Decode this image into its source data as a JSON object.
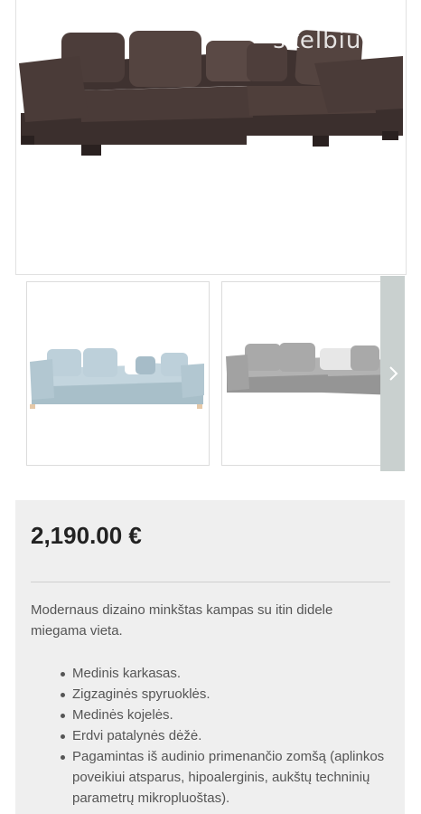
{
  "gallery": {
    "watermark": "skelbiu.lt",
    "next_icon": "chevron-right-icon"
  },
  "listing": {
    "price": "2,190.00 €",
    "description": "Modernaus dizaino minkštas kampas su itin didele miegama vieta.",
    "features": [
      "Medinis karkasas.",
      "Zigzaginės spyruoklės.",
      "Medinės kojelės.",
      "Erdvi patalynės dėžė.",
      "Pagamintas iš audinio primenančio zomšą (aplinkos poveikiui atsparus, hipoalerginis, aukštų techninių parametrų mikropluoštas)."
    ]
  },
  "colors": {
    "main_sofa": "#4a3b38",
    "thumb1_sofa": "#b9ccd6",
    "thumb2_sofa": "#a7a7a7",
    "arrow_bg": "#c9d0cf",
    "info_bg": "#efefef"
  }
}
